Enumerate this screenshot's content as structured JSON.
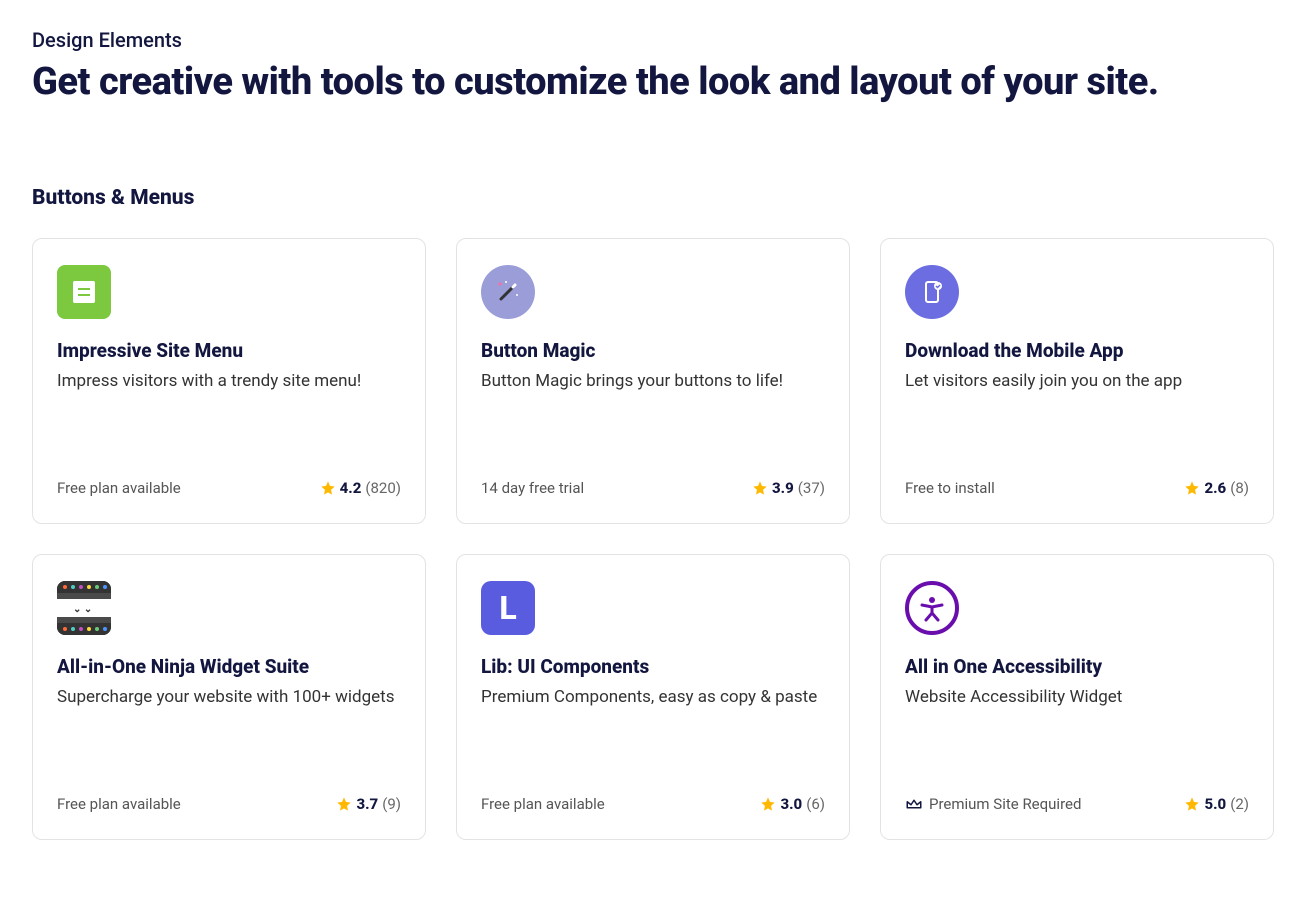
{
  "header": {
    "subtitle": "Design Elements",
    "title": "Get creative with tools to customize the look and layout of your site."
  },
  "section": {
    "title": "Buttons & Menus"
  },
  "cards": [
    {
      "icon": "menu-icon",
      "title": "Impressive Site Menu",
      "description": "Impress visitors with a trendy site menu!",
      "plan": "Free plan available",
      "premium": false,
      "rating": "4.2",
      "ratingCount": "(820)"
    },
    {
      "icon": "magic-icon",
      "title": "Button Magic",
      "description": "Button Magic brings your buttons to life!",
      "plan": "14 day free trial",
      "premium": false,
      "rating": "3.9",
      "ratingCount": "(37)"
    },
    {
      "icon": "mobile-icon",
      "title": "Download the Mobile App",
      "description": "Let visitors easily join you on the app",
      "plan": "Free to install",
      "premium": false,
      "rating": "2.6",
      "ratingCount": "(8)"
    },
    {
      "icon": "ninja-icon",
      "title": "All-in-One Ninja Widget Suite",
      "description": "Supercharge your website with 100+ widgets",
      "plan": "Free plan available",
      "premium": false,
      "rating": "3.7",
      "ratingCount": "(9)"
    },
    {
      "icon": "lib-icon",
      "title": "Lib: UI Components",
      "description": "Premium Components, easy as copy & paste",
      "plan": "Free plan available",
      "premium": false,
      "rating": "3.0",
      "ratingCount": "(6)"
    },
    {
      "icon": "accessibility-icon",
      "title": "All in One Accessibility",
      "description": "Website Accessibility Widget",
      "plan": "Premium Site Required",
      "premium": true,
      "rating": "5.0",
      "ratingCount": "(2)"
    }
  ]
}
